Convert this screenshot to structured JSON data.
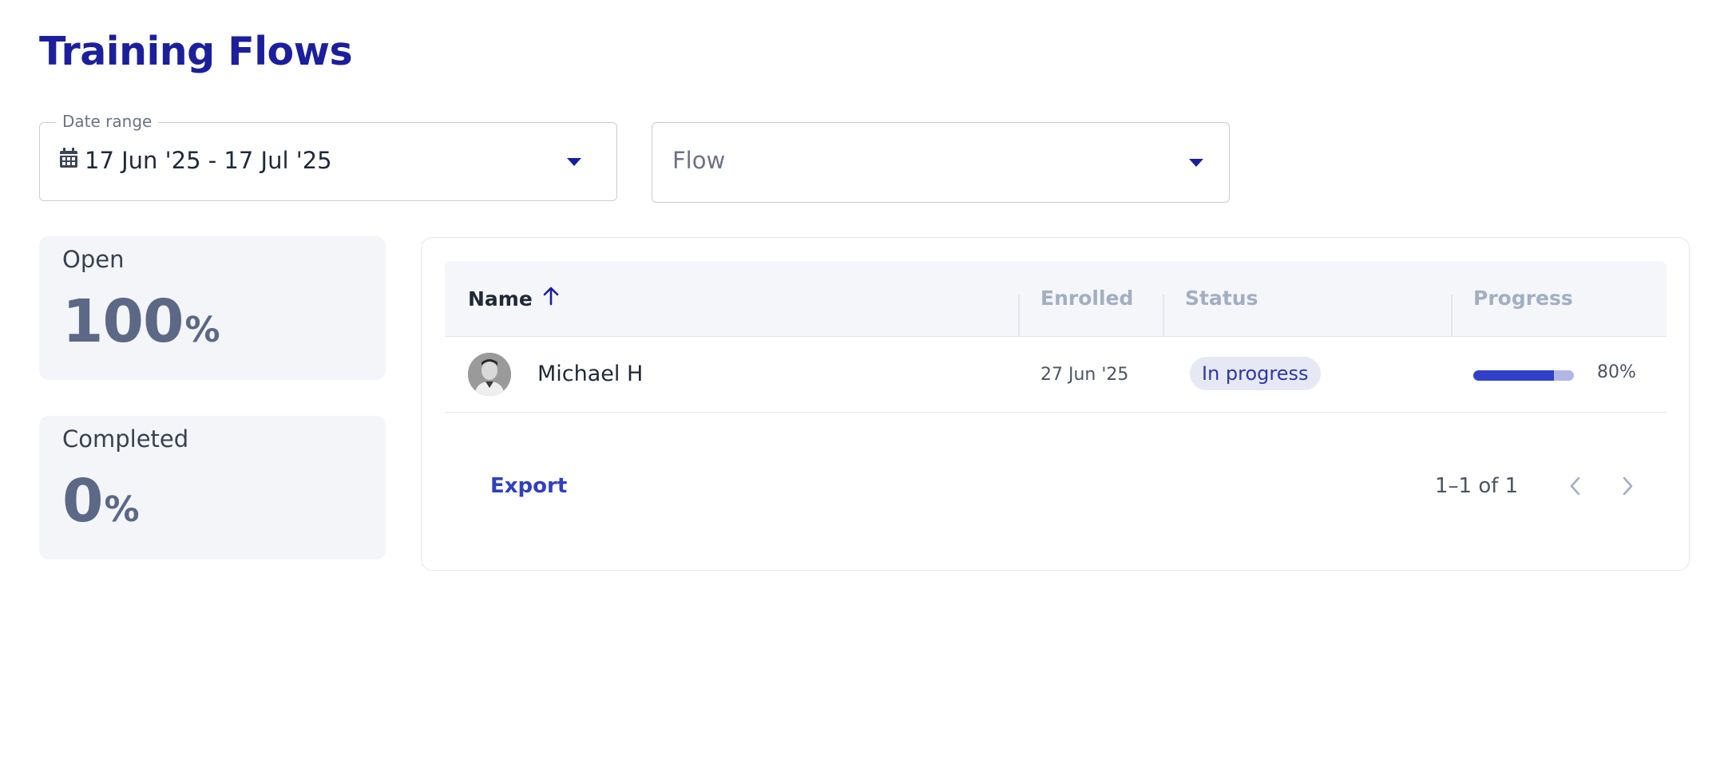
{
  "page": {
    "title": "Training Flows"
  },
  "filters": {
    "date_range": {
      "label": "Date range",
      "value": "17 Jun '25 - 17 Jul '25",
      "icon": "calendar-icon"
    },
    "flow": {
      "placeholder": "Flow"
    }
  },
  "stats": {
    "open": {
      "label": "Open",
      "value": "100",
      "unit": "%"
    },
    "completed": {
      "label": "Completed",
      "value": "0",
      "unit": "%"
    }
  },
  "table": {
    "columns": {
      "name": "Name",
      "enrolled": "Enrolled",
      "status": "Status",
      "progress": "Progress"
    },
    "sort": {
      "column": "name",
      "direction": "ascending"
    },
    "rows": [
      {
        "name": "Michael H",
        "enrolled": "27 Jun '25",
        "status": "In progress",
        "progress_label": "80%",
        "progress": 0.8
      }
    ],
    "footer": {
      "export_label": "Export",
      "pagination": "1–1 of 1"
    }
  },
  "colors": {
    "primary": "#1c1f9c",
    "accent": "#3040c8",
    "muted": "#5b6886"
  }
}
